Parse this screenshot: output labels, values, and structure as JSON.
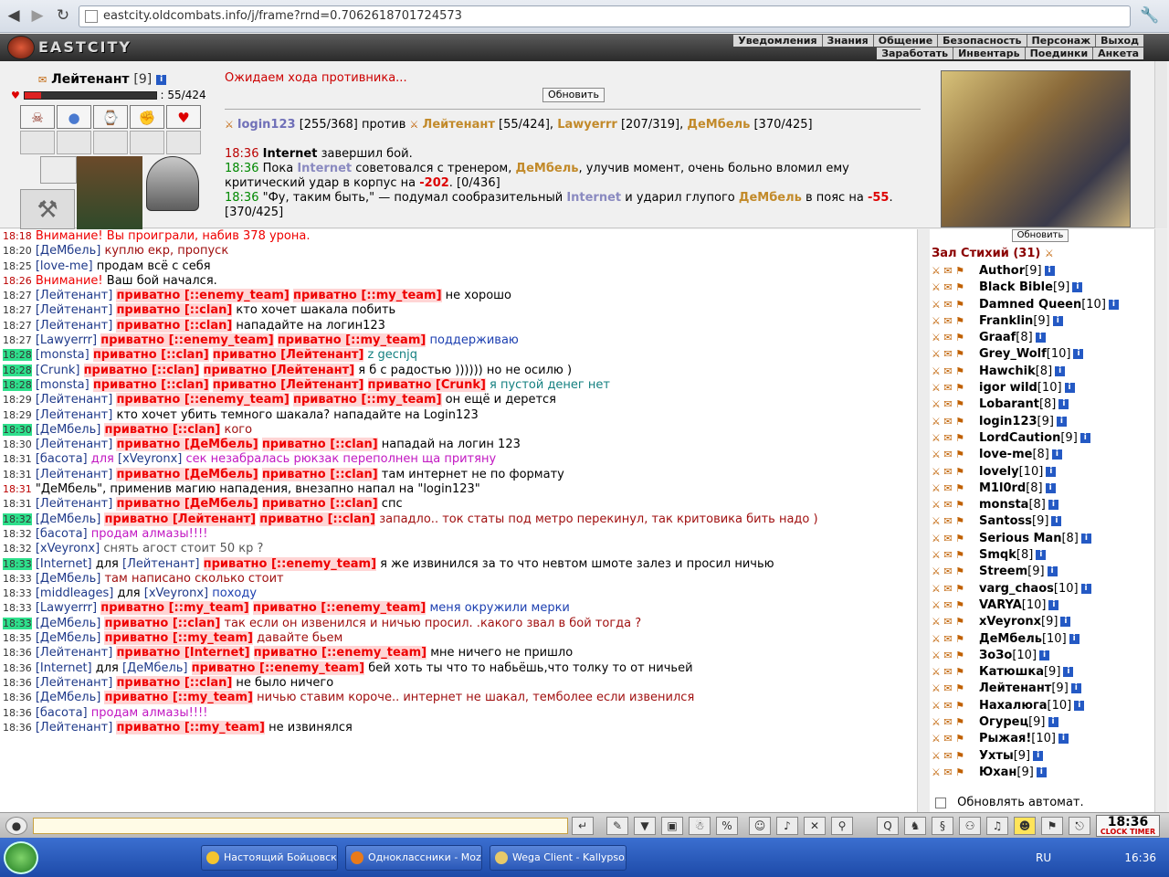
{
  "browser": {
    "url": "eastcity.oldcombats.info/j/frame?rnd=0.7062618701724573"
  },
  "header": {
    "logo_text": "EASTCITY",
    "menu_row1": [
      "Уведомления",
      "Знания",
      "Общение",
      "Безопасность",
      "Персонаж",
      "Выход"
    ],
    "menu_row2": [
      "Заработать",
      "Инвентарь",
      "Поединки",
      "Анкета"
    ]
  },
  "player": {
    "name": "Лейтенант",
    "level": "[9]",
    "hp_text": ": 55/424",
    "hp_fraction": 0.13
  },
  "battle": {
    "status": "Ожидаем хода противника...",
    "refresh_label": "Обновить",
    "fight": {
      "p1": "login123",
      "p1_hp": "[255/368]",
      "versus": "против",
      "p2": "Лейтенант",
      "p2_hp": "[55/424],",
      "p3": "Lawyerrr",
      "p3_hp": "[207/319],",
      "p4": "ДеМбель",
      "p4_hp": "[370/425]"
    },
    "log": [
      {
        "time": "18:36",
        "a": "Internet",
        "b": "завершил бой."
      },
      {
        "time": "18:36",
        "a": "Пока",
        "b": "Internet",
        "c": "советовался с тренером,",
        "d": "ДеМбель",
        "e": ", улучив момент, очень больно вломил ему критический удар в корпус на",
        "f": "-202",
        "g": ". [0/436]"
      },
      {
        "time": "18:36",
        "a": "\"Фу, таким быть,\" — подумал сообразительный",
        "b": "Internet",
        "c": "и ударил глупого",
        "d": "ДеМбель",
        "e": "в пояс на",
        "f": "-55",
        "g": ". [370/425]"
      }
    ]
  },
  "chat": {
    "lines": [
      {
        "t": "18:18",
        "tc": "r",
        "parts": [
          [
            "sys",
            "Внимание! Вы проиграли, набив 378 урона."
          ]
        ]
      },
      {
        "t": "18:20",
        "tc": "",
        "parts": [
          [
            "nm",
            "[ДеМбель]"
          ],
          [
            "msg-red",
            " куплю екр, пропуск"
          ]
        ]
      },
      {
        "t": "18:25",
        "tc": "",
        "parts": [
          [
            "nm",
            "[love-me]"
          ],
          [
            "",
            " продам всё с себя"
          ]
        ]
      },
      {
        "t": "18:26",
        "tc": "r",
        "parts": [
          [
            "sys",
            "Внимание!"
          ],
          [
            "",
            " Ваш бой начался."
          ]
        ]
      },
      {
        "t": "18:27",
        "tc": "",
        "parts": [
          [
            "nm",
            "[Лейтенант] "
          ],
          [
            "pv",
            "приватно [::enemy_team]"
          ],
          [
            "",
            " "
          ],
          [
            "pv",
            "приватно [::my_team]"
          ],
          [
            "",
            " не хорошо"
          ]
        ]
      },
      {
        "t": "18:27",
        "tc": "",
        "parts": [
          [
            "nm",
            "[Лейтенант] "
          ],
          [
            "pv",
            "приватно [::clan]"
          ],
          [
            "",
            " кто хочет шакала побить"
          ]
        ]
      },
      {
        "t": "18:27",
        "tc": "",
        "parts": [
          [
            "nm",
            "[Лейтенант] "
          ],
          [
            "pv",
            "приватно [::clan]"
          ],
          [
            "",
            " нападайте на логин123"
          ]
        ]
      },
      {
        "t": "18:27",
        "tc": "",
        "parts": [
          [
            "nm",
            "[Lawyerrr] "
          ],
          [
            "pv",
            "приватно [::enemy_team]"
          ],
          [
            "",
            " "
          ],
          [
            "pv",
            "приватно [::my_team]"
          ],
          [
            "msg-blue",
            " поддерживаю"
          ]
        ]
      },
      {
        "t": "18:28",
        "tc": "g",
        "parts": [
          [
            "nm",
            "[monsta] "
          ],
          [
            "pv",
            "приватно [::clan]"
          ],
          [
            "",
            " "
          ],
          [
            "pv",
            "приватно [Лейтенант]"
          ],
          [
            "msg-teal",
            " z gecnjq"
          ]
        ]
      },
      {
        "t": "18:28",
        "tc": "g",
        "parts": [
          [
            "nm",
            "[Crunk] "
          ],
          [
            "pv",
            "приватно [::clan]"
          ],
          [
            "",
            " "
          ],
          [
            "pv",
            "приватно [Лейтенант]"
          ],
          [
            "",
            " я б с радостью )))))) но не осилю )"
          ]
        ]
      },
      {
        "t": "18:28",
        "tc": "g",
        "parts": [
          [
            "nm",
            "[monsta] "
          ],
          [
            "pv",
            "приватно [::clan]"
          ],
          [
            "",
            " "
          ],
          [
            "pv",
            "приватно [Лейтенант]"
          ],
          [
            "",
            " "
          ],
          [
            "pv",
            "приватно [Crunk]"
          ],
          [
            "msg-teal",
            " я пустой денег нет"
          ]
        ]
      },
      {
        "t": "18:29",
        "tc": "",
        "parts": [
          [
            "nm",
            "[Лейтенант] "
          ],
          [
            "pv",
            "приватно [::enemy_team]"
          ],
          [
            "",
            " "
          ],
          [
            "pv",
            "приватно [::my_team]"
          ],
          [
            "",
            " он ещё и дерется"
          ]
        ]
      },
      {
        "t": "18:29",
        "tc": "",
        "parts": [
          [
            "nm",
            "[Лейтенант]"
          ],
          [
            "",
            " кто хочет убить темного шакала? нападайте на Login123"
          ]
        ]
      },
      {
        "t": "18:30",
        "tc": "g",
        "parts": [
          [
            "nm",
            "[ДеМбель] "
          ],
          [
            "pv",
            "приватно [::clan]"
          ],
          [
            "msg-red",
            " кого"
          ]
        ]
      },
      {
        "t": "18:30",
        "tc": "",
        "parts": [
          [
            "nm",
            "[Лейтенант] "
          ],
          [
            "pv",
            "приватно [ДеМбель]"
          ],
          [
            "",
            " "
          ],
          [
            "pv",
            "приватно [::clan]"
          ],
          [
            "",
            " нападай на логин 123"
          ]
        ]
      },
      {
        "t": "18:31",
        "tc": "",
        "parts": [
          [
            "nm",
            "[басота]"
          ],
          [
            "msg-mag",
            " для "
          ],
          [
            "nm",
            "[xVeyronx]"
          ],
          [
            "msg-mag",
            " сек незабралась рюкзак переполнен ща притяну"
          ]
        ]
      },
      {
        "t": "18:31",
        "tc": "",
        "parts": [
          [
            "nm",
            "[Лейтенант] "
          ],
          [
            "pv",
            "приватно [ДеМбель]"
          ],
          [
            "",
            " "
          ],
          [
            "pv",
            "приватно [::clan]"
          ],
          [
            "",
            " там интернет не по формату"
          ]
        ]
      },
      {
        "t": "18:31",
        "tc": "r",
        "parts": [
          [
            "",
            " \"ДеМбель\", применив магию нападения, внезапно напал на \"login123\""
          ]
        ]
      },
      {
        "t": "18:31",
        "tc": "",
        "parts": [
          [
            "nm",
            "[Лейтенант] "
          ],
          [
            "pv",
            "приватно [ДеМбель]"
          ],
          [
            "",
            " "
          ],
          [
            "pv",
            "приватно [::clan]"
          ],
          [
            "",
            " спс"
          ]
        ]
      },
      {
        "t": "18:32",
        "tc": "g",
        "parts": [
          [
            "nm",
            "[ДеМбель] "
          ],
          [
            "pv",
            "приватно [Лейтенант]"
          ],
          [
            "",
            " "
          ],
          [
            "pv",
            "приватно [::clan]"
          ],
          [
            "msg-red",
            " западло.. ток статы под метро перекинул, так критовика бить надо )"
          ]
        ]
      },
      {
        "t": "18:32",
        "tc": "",
        "parts": [
          [
            "nm",
            "[басота]"
          ],
          [
            "msg-mag",
            " продам алмазы!!!!"
          ]
        ]
      },
      {
        "t": "18:32",
        "tc": "",
        "parts": [
          [
            "nm",
            "[xVeyronx]"
          ],
          [
            "msg-gray",
            " снять агост стоит 50 кр ?"
          ]
        ]
      },
      {
        "t": "18:33",
        "tc": "g",
        "parts": [
          [
            "nm",
            "[Internet]"
          ],
          [
            "",
            " для "
          ],
          [
            "nm",
            "[Лейтенант] "
          ],
          [
            "pv",
            "приватно [::enemy_team]"
          ],
          [
            "",
            " я же извинился за то что невтом шмоте залез и просил ничью"
          ]
        ]
      },
      {
        "t": "18:33",
        "tc": "",
        "parts": [
          [
            "nm",
            "[ДеМбель]"
          ],
          [
            "msg-red",
            " там написано сколько стоит"
          ]
        ]
      },
      {
        "t": "18:33",
        "tc": "",
        "parts": [
          [
            "nm",
            "[middleages]"
          ],
          [
            "",
            " для "
          ],
          [
            "nm",
            "[xVeyronx]"
          ],
          [
            "msg-blue",
            " походу"
          ]
        ]
      },
      {
        "t": "18:33",
        "tc": "",
        "parts": [
          [
            "nm",
            "[Lawyerrr] "
          ],
          [
            "pv",
            "приватно [::my_team]"
          ],
          [
            "",
            " "
          ],
          [
            "pv",
            "приватно [::enemy_team]"
          ],
          [
            "msg-blue",
            " меня окружили мерки"
          ]
        ]
      },
      {
        "t": "18:33",
        "tc": "g",
        "parts": [
          [
            "nm",
            "[ДеМбель] "
          ],
          [
            "pv",
            "приватно [::clan]"
          ],
          [
            "msg-red",
            " так если он извенился и ничью просил. .какого звал в бой тогда ?"
          ]
        ]
      },
      {
        "t": "18:35",
        "tc": "",
        "parts": [
          [
            "nm",
            "[ДеМбель] "
          ],
          [
            "pv",
            "приватно [::my_team]"
          ],
          [
            "msg-red",
            " давайте бьем"
          ]
        ]
      },
      {
        "t": "18:36",
        "tc": "",
        "parts": [
          [
            "nm",
            "[Лейтенант] "
          ],
          [
            "pv",
            "приватно [Internet]"
          ],
          [
            "",
            " "
          ],
          [
            "pv",
            "приватно [::enemy_team]"
          ],
          [
            "",
            " мне ничего не пришло"
          ]
        ]
      },
      {
        "t": "18:36",
        "tc": "",
        "parts": [
          [
            "nm",
            "[Internet]"
          ],
          [
            "",
            " для "
          ],
          [
            "nm",
            "[ДеМбель] "
          ],
          [
            "pv",
            "приватно [::enemy_team]"
          ],
          [
            "",
            " бей хоть ты что то набьёшь,что толку то от ничьей"
          ]
        ]
      },
      {
        "t": "18:36",
        "tc": "",
        "parts": [
          [
            "nm",
            "[Лейтенант] "
          ],
          [
            "pv",
            "приватно [::clan]"
          ],
          [
            "",
            " не было ничего"
          ]
        ]
      },
      {
        "t": "18:36",
        "tc": "",
        "parts": [
          [
            "nm",
            "[ДеМбель] "
          ],
          [
            "pv",
            "приватно [::my_team]"
          ],
          [
            "msg-red",
            " ничью ставим короче.. интернет не шакал, темболее если извенился"
          ]
        ]
      },
      {
        "t": "18:36",
        "tc": "",
        "parts": [
          [
            "nm",
            "[басота]"
          ],
          [
            "msg-mag",
            " продам алмазы!!!!"
          ]
        ]
      },
      {
        "t": "18:36",
        "tc": "",
        "parts": [
          [
            "nm",
            "[Лейтенант] "
          ],
          [
            "pv",
            "приватно [::my_team]"
          ],
          [
            "",
            " не извинялся"
          ]
        ]
      }
    ]
  },
  "userlist": {
    "refresh_label": "Обновить",
    "room": "Зал Стихий (31)",
    "users": [
      [
        "Author",
        "[9]"
      ],
      [
        "Black Bible",
        "[9]"
      ],
      [
        "Damned Queen",
        "[10]"
      ],
      [
        "Franklin",
        "[9]"
      ],
      [
        "Graaf",
        "[8]"
      ],
      [
        "Grey_Wolf",
        "[10]"
      ],
      [
        "Hawchik",
        "[8]"
      ],
      [
        "igor wild",
        "[10]"
      ],
      [
        "Lobarant",
        "[8]"
      ],
      [
        "login123",
        "[9]"
      ],
      [
        "LordCaution",
        "[9]"
      ],
      [
        "love-me",
        "[8]"
      ],
      [
        "lovely",
        "[10]"
      ],
      [
        "M1l0rd",
        "[8]"
      ],
      [
        "monsta",
        "[8]"
      ],
      [
        "Santoss",
        "[9]"
      ],
      [
        "Serious Man",
        "[8]"
      ],
      [
        "Smqk",
        "[8]"
      ],
      [
        "Streem",
        "[9]"
      ],
      [
        "varg_chaos",
        "[10]"
      ],
      [
        "VARYA",
        "[10]"
      ],
      [
        "xVeyronx",
        "[9]"
      ],
      [
        "ДеМбель",
        "[10]"
      ],
      [
        "ЗоЗо",
        "[10]"
      ],
      [
        "Катюшка",
        "[9]"
      ],
      [
        "Лейтенант",
        "[9]"
      ],
      [
        "Нахалюга",
        "[10]"
      ],
      [
        "Огурец",
        "[9]"
      ],
      [
        "Рыжая!",
        "[10]"
      ],
      [
        "Ухты",
        "[9]"
      ],
      [
        "Юхан",
        "[9]"
      ]
    ],
    "auto_refresh_label": "Обновлять автомат."
  },
  "toolbar": {
    "clock": "18:36",
    "clock_label": "CLOCK TIMER"
  },
  "taskbar": {
    "tasks": [
      "Настоящий Бойцовск...",
      "Одноклассники - Moz...",
      "Wega Client - Kallypso..."
    ],
    "lang": "RU",
    "time": "16:36"
  }
}
